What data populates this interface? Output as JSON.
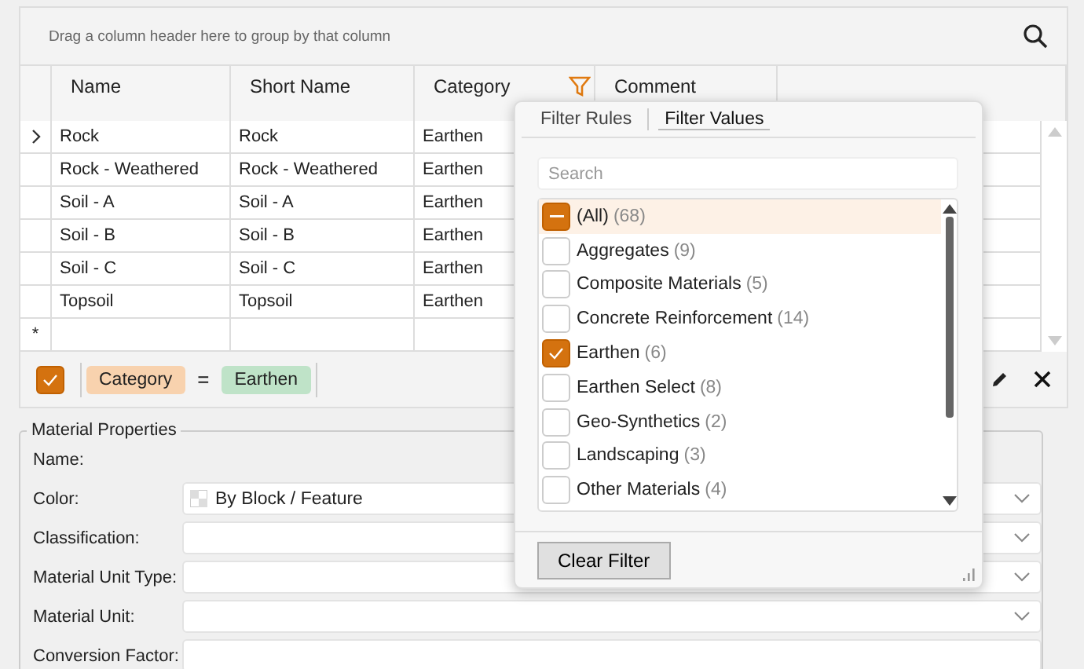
{
  "group_panel": {
    "hint": "Drag a column header here to group by that column"
  },
  "grid": {
    "columns": [
      {
        "label": "Name",
        "filtered": false
      },
      {
        "label": "Short Name",
        "filtered": false
      },
      {
        "label": "Category",
        "filtered": true
      },
      {
        "label": "Comment",
        "filtered": false
      }
    ],
    "rows": [
      {
        "current": true,
        "cells": [
          "Rock",
          "Rock",
          "Earthen",
          ""
        ]
      },
      {
        "current": false,
        "cells": [
          "Rock - Weathered",
          "Rock - Weathered",
          "Earthen",
          ""
        ]
      },
      {
        "current": false,
        "cells": [
          "Soil - A",
          "Soil - A",
          "Earthen",
          ""
        ]
      },
      {
        "current": false,
        "cells": [
          "Soil - B",
          "Soil - B",
          "Earthen",
          ""
        ]
      },
      {
        "current": false,
        "cells": [
          "Soil - C",
          "Soil - C",
          "Earthen",
          ""
        ]
      },
      {
        "current": false,
        "cells": [
          "Topsoil",
          "Topsoil",
          "Earthen",
          ""
        ]
      }
    ],
    "new_row_marker": "*"
  },
  "filter_bar": {
    "enabled": true,
    "field": "Category",
    "operator": "=",
    "value": "Earthen"
  },
  "properties": {
    "title": "Material Properties",
    "fields": [
      {
        "kind": "label",
        "label": "Name:"
      },
      {
        "kind": "combo",
        "label": "Color:",
        "value": "By Block / Feature",
        "swatch": true
      },
      {
        "kind": "combo",
        "label": "Classification:"
      },
      {
        "kind": "combo",
        "label": "Material Unit Type:"
      },
      {
        "kind": "combo",
        "label": "Material Unit:"
      },
      {
        "kind": "text",
        "label": "Conversion Factor:"
      }
    ]
  },
  "filter_popup": {
    "tabs": [
      {
        "label": "Filter Rules",
        "selected": false
      },
      {
        "label": "Filter Values",
        "selected": true
      }
    ],
    "search": {
      "placeholder": "Search"
    },
    "values": [
      {
        "label": "(All)",
        "count": "(68)",
        "checked": true,
        "indeterminate": true,
        "highlighted": true
      },
      {
        "label": "Aggregates",
        "count": "(9)",
        "checked": false,
        "indeterminate": false,
        "highlighted": false
      },
      {
        "label": "Composite Materials",
        "count": "(5)",
        "checked": false,
        "indeterminate": false,
        "highlighted": false
      },
      {
        "label": "Concrete Reinforcement",
        "count": "(14)",
        "checked": false,
        "indeterminate": false,
        "highlighted": false
      },
      {
        "label": "Earthen",
        "count": "(6)",
        "checked": true,
        "indeterminate": false,
        "highlighted": false
      },
      {
        "label": "Earthen Select",
        "count": "(8)",
        "checked": false,
        "indeterminate": false,
        "highlighted": false
      },
      {
        "label": "Geo-Synthetics",
        "count": "(2)",
        "checked": false,
        "indeterminate": false,
        "highlighted": false
      },
      {
        "label": "Landscaping",
        "count": "(3)",
        "checked": false,
        "indeterminate": false,
        "highlighted": false
      },
      {
        "label": "Other Materials",
        "count": "(4)",
        "checked": false,
        "indeterminate": false,
        "highlighted": false
      }
    ],
    "clear_button": "Clear Filter"
  }
}
